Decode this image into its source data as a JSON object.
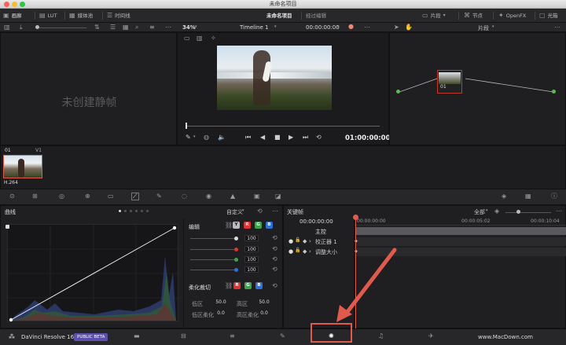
{
  "window": {
    "title": "未命名项目"
  },
  "topbar": {
    "gallery": "画廊",
    "lut": "LUT",
    "media_pool": "媒体池",
    "timeline": "时间线",
    "project_name": "未命名项目",
    "edited": "经过编辑",
    "clips": "片段",
    "nodes": "节点",
    "openfx": "OpenFX",
    "lightbox": "光箱"
  },
  "viewer": {
    "zoom": "34%",
    "timeline_name": "Timeline 1",
    "timecode_top": "00:00:00:00",
    "timecode_bottom": "01:00:00:00"
  },
  "node_editor": {
    "mode": "片段",
    "node_label": "01"
  },
  "gallery": {
    "empty_text": "未创建静帧"
  },
  "clip": {
    "number": "01",
    "track": "V1",
    "codec": "H.264"
  },
  "curves": {
    "title": "曲线",
    "preset": "自定义",
    "edit_label": "编辑",
    "y_label": "Y",
    "r_label": "R",
    "g_label": "G",
    "b_label": "B",
    "values": [
      "100",
      "100",
      "100",
      "100"
    ],
    "soft_clip_label": "柔化裁切",
    "low_label": "低区",
    "low_value": "50.0",
    "high_label": "高区",
    "high_value": "50.0",
    "low_soft_label": "低区柔化",
    "low_soft_value": "0.0",
    "high_soft_label": "高区柔化",
    "high_soft_value": "0.0"
  },
  "keyframes": {
    "title": "关键帧",
    "filter": "全部",
    "tc_current": "00:00:00:00",
    "tc_0": "00:00:00:00",
    "tc_1": "00:00:05:02",
    "tc_2": "00:00:10:04",
    "master": "主控",
    "row1": "校正器 1",
    "row2": "调整大小"
  },
  "bottom": {
    "app": "DaVinci Resolve 16",
    "badge": "PUBLIC BETA",
    "watermark": "www.MacDown.com"
  },
  "colors": {
    "accent_red": "#e05a4e",
    "badge": "#5b4fb0",
    "green": "#3fa34d",
    "blue": "#2f6fd8",
    "red": "#d33"
  }
}
